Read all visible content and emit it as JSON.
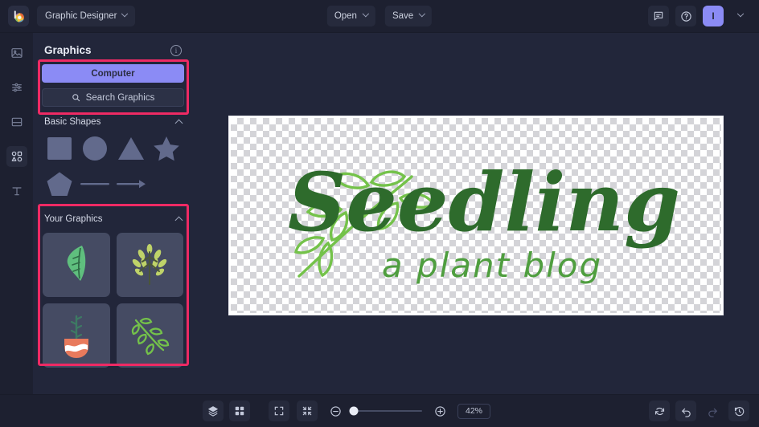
{
  "app": {
    "logo_name": "bolt-logo",
    "document_name": "Graphic Designer",
    "accent_purple": "#8b8bf5",
    "annotation_color": "#ee2a64",
    "panel_bg": "#22263a",
    "chrome_bg": "#1d2030"
  },
  "topbar": {
    "open_label": "Open",
    "save_label": "Save",
    "comments_icon": "comment-icon",
    "help_icon": "help-icon",
    "avatar_initial": "I"
  },
  "rail": {
    "items": [
      {
        "name": "images",
        "icon": "image-icon",
        "active": false
      },
      {
        "name": "adjustments",
        "icon": "sliders-icon",
        "active": false
      },
      {
        "name": "layouts",
        "icon": "layout-icon",
        "active": false
      },
      {
        "name": "graphics",
        "icon": "shapes-icon",
        "active": true
      },
      {
        "name": "text",
        "icon": "text-icon",
        "active": false
      }
    ]
  },
  "panel": {
    "title": "Graphics",
    "info_icon": "info-icon",
    "source_button": "Computer",
    "search_placeholder": "Search Graphics",
    "search_icon": "search-icon",
    "sections": [
      {
        "title": "Basic Shapes",
        "collapse_icon": "chevron-up-icon",
        "shapes": [
          "square",
          "circle",
          "triangle",
          "star",
          "pentagon",
          "line",
          "arrow"
        ]
      },
      {
        "title": "Your Graphics",
        "collapse_icon": "chevron-up-icon",
        "thumbnails": [
          "leaf-graphic",
          "wheat-sprig-graphic",
          "potted-seedling-graphic",
          "leafy-branch-graphic"
        ]
      }
    ]
  },
  "canvas": {
    "artboard_title": "Seedling",
    "artboard_subtitle": "a plant blog",
    "logo_dark_green": "#2e6b2c",
    "logo_light_green": "#73bf44",
    "background": "transparent-checkerboard"
  },
  "bottombar": {
    "layers_icon": "layers-icon",
    "grid_icon": "grid-icon",
    "fullscreen_icon": "fullscreen-icon",
    "fit_icon": "fit-to-screen-icon",
    "zoom_out_icon": "zoom-out-icon",
    "zoom_in_icon": "zoom-in-icon",
    "zoom_level": "42%",
    "reset_icon": "reset-icon",
    "undo_icon": "undo-icon",
    "redo_icon": "redo-icon",
    "history_icon": "history-icon"
  }
}
